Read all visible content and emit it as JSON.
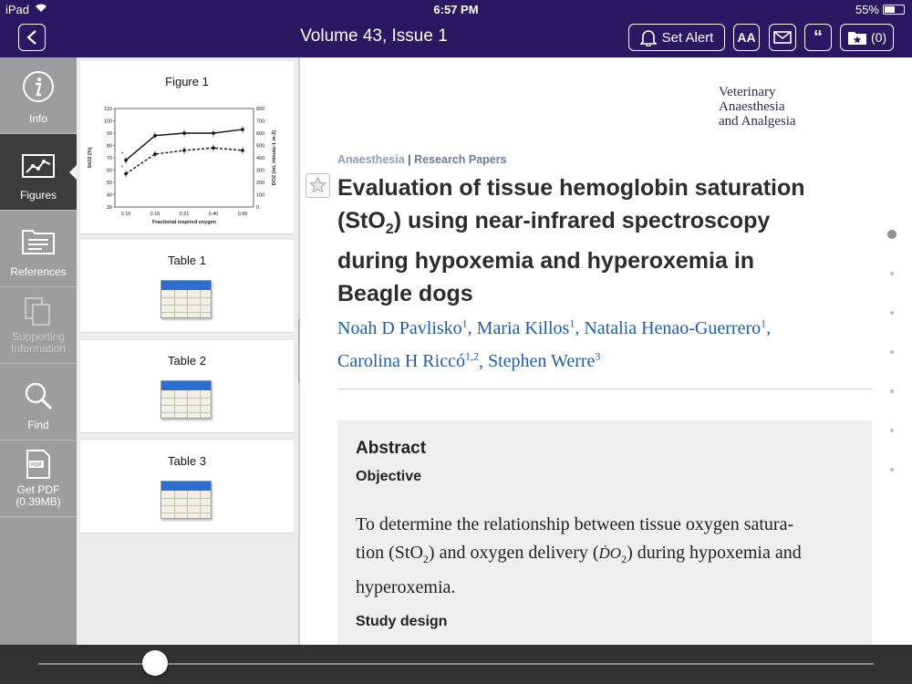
{
  "status_bar": {
    "device": "iPad",
    "time": "6:57 PM",
    "battery": "55%"
  },
  "nav": {
    "title": "Volume 43, Issue 1",
    "set_alert_label": "Set Alert",
    "font_size_label": "AA",
    "cite_label": "“",
    "saved_count": "(0)"
  },
  "rail": {
    "items": [
      {
        "label": "Info",
        "icon": "info-icon"
      },
      {
        "label": "Figures",
        "icon": "chart-icon",
        "active": true
      },
      {
        "label": "References",
        "icon": "references-icon"
      },
      {
        "label": "Supporting Information",
        "icon": "copy-icon",
        "disabled": true
      },
      {
        "label": "Find",
        "icon": "search-icon"
      },
      {
        "label": "Get PDF (0.39MB)",
        "icon": "pdf-icon"
      }
    ]
  },
  "thumbnails": {
    "figure1": {
      "title": "Figure 1",
      "chart_data": {
        "type": "line",
        "categories": [
          "0.10",
          "0.15",
          "0.21",
          "0.40",
          "0.95"
        ],
        "xlabel": "Fractional inspired oxygen",
        "ylabel": "StO2 (%)",
        "ylabel_right": "DO2 (mL minute-1 m-2)",
        "ylim": [
          30,
          110
        ],
        "yticks": [
          "110",
          "100",
          "90",
          "80",
          "70",
          "60",
          "50",
          "40",
          "30"
        ],
        "ylim_right": [
          0,
          800
        ],
        "yticks_right": [
          "800",
          "700",
          "600",
          "500",
          "400",
          "300",
          "200",
          "100",
          "0"
        ],
        "series": [
          {
            "values": [
              68,
              88,
              90,
              90,
              93
            ],
            "style": "solid"
          },
          {
            "values": [
              57,
              73,
              76,
              78,
              76
            ],
            "style": "dashed"
          }
        ],
        "markers": [
          "*",
          "*"
        ]
      }
    },
    "tables": [
      {
        "title": "Table 1"
      },
      {
        "title": "Table 2"
      },
      {
        "title": "Table 3"
      }
    ]
  },
  "article": {
    "journal": [
      "Veterinary",
      "Anaesthesia",
      "and Analgesia"
    ],
    "section_primary": "Anaesthesia",
    "section_sep": "|",
    "section_secondary": "Research Papers",
    "title_l1": "Evaluation of tissue hemoglobin saturation",
    "title_l2_pre": "(StO",
    "title_l2_sub": "2",
    "title_l2_post": ") using near-infrared spectroscopy",
    "title_l3": "during hypoxemia and hyperoxemia in",
    "title_l4": "Beagle dogs",
    "authors": [
      {
        "name": "Noah D Pavlisko",
        "aff": "1",
        "sep": ", "
      },
      {
        "name": "Maria Killos",
        "aff": "1",
        "sep": ", "
      },
      {
        "name": "Natalia Henao-Guerrero",
        "aff": "1",
        "sep": ", "
      },
      {
        "name": "Carolina H Riccó",
        "aff": "1,2",
        "sep": ", "
      },
      {
        "name": "Stephen Werre",
        "aff": "3",
        "sep": ""
      }
    ],
    "abstract": {
      "heading": "Abstract",
      "objective_heading": "Objective",
      "line1": "To determine the relationship between tissue oxygen satura-",
      "line2_a": "tion (StO",
      "line2_sub1": "2",
      "line2_b": ") and oxygen delivery (",
      "line2_do": "ḊO",
      "line2_sub2": "2",
      "line2_c": ") during hypoxemia and",
      "line3": "hyperoxemia.",
      "study_design_heading": "Study design"
    }
  },
  "pager": {
    "pages": 7,
    "current": 1
  },
  "scrubber": {
    "position": 0.14
  }
}
